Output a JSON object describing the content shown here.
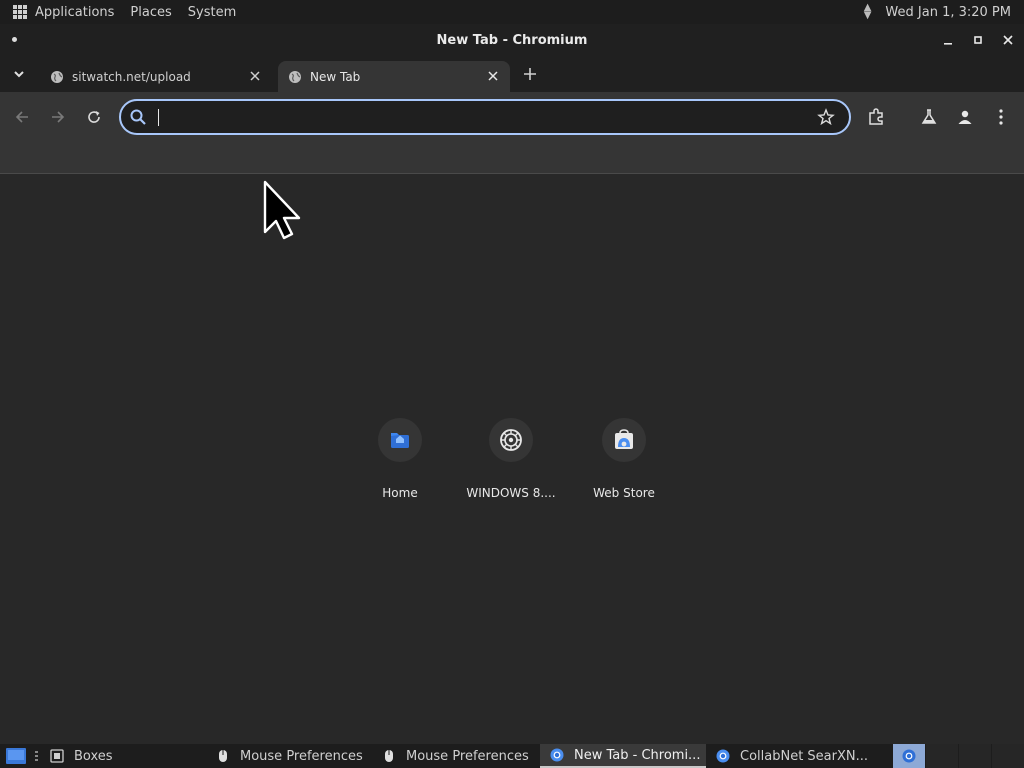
{
  "top_panel": {
    "menus": [
      "Applications",
      "Places",
      "System"
    ],
    "clock": "Wed Jan 1,  3:20 PM"
  },
  "window": {
    "title": "New Tab - Chromium"
  },
  "tabs": [
    {
      "label": "sitwatch.net/upload",
      "active": false
    },
    {
      "label": "New Tab",
      "active": true
    }
  ],
  "omnibox": {
    "value": "",
    "placeholder": ""
  },
  "shortcuts": [
    {
      "label": "Home",
      "icon": "home-folder-icon"
    },
    {
      "label": "WINDOWS 8....",
      "icon": "gear-wheel-icon"
    },
    {
      "label": "Web Store",
      "icon": "web-store-icon"
    }
  ],
  "taskbar": {
    "items": [
      {
        "label": "Boxes",
        "icon": "boxes-icon",
        "active": false
      },
      {
        "label": "Mouse Preferences",
        "icon": "mouse-icon",
        "active": false
      },
      {
        "label": "Mouse Preferences",
        "icon": "mouse-icon",
        "active": false
      },
      {
        "label": "New Tab - Chromi...",
        "icon": "chromium-icon",
        "active": true
      },
      {
        "label": "CollabNet SearXN...",
        "icon": "chromium-icon",
        "active": false
      }
    ]
  },
  "colors": {
    "accent": "#a8c7fa",
    "toolbar": "#353535",
    "background": "#282828",
    "panel": "#1d1d1d"
  }
}
